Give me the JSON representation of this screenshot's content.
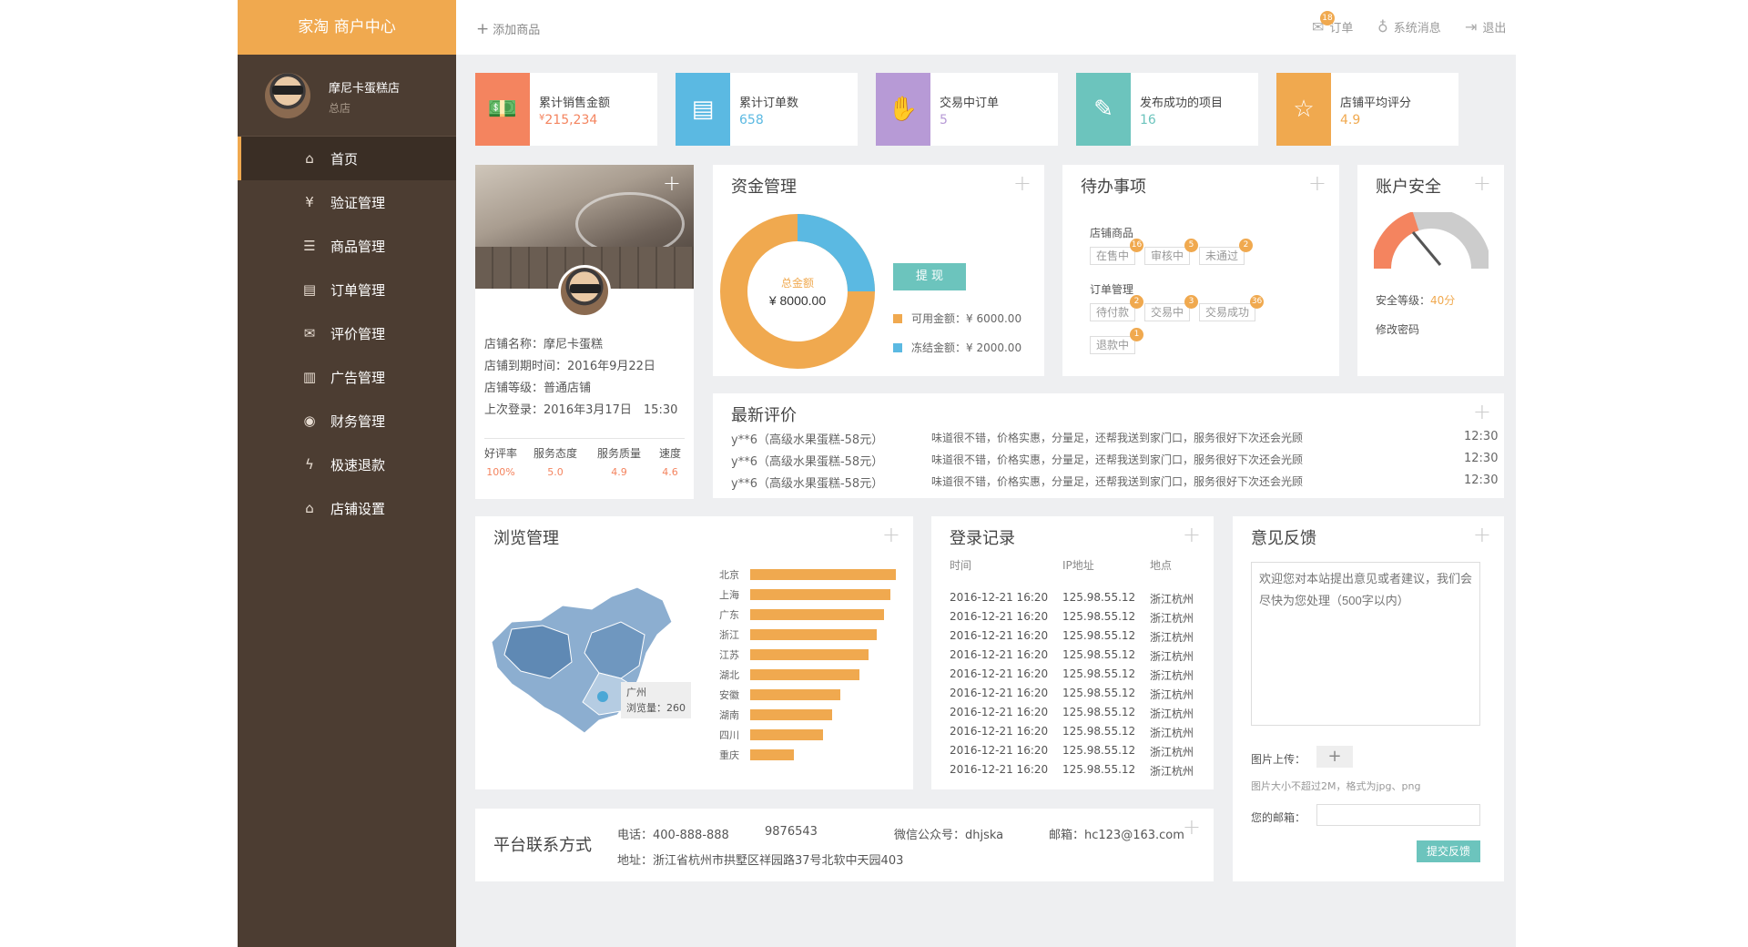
{
  "sidebar": {
    "brand": "家淘 商户中心",
    "user_name": "摩尼卡蛋糕店",
    "user_role": "总店",
    "items": [
      {
        "label": "首页",
        "icon": "home-icon",
        "glyph": "⌂"
      },
      {
        "label": "验证管理",
        "icon": "ticket-icon",
        "glyph": "¥"
      },
      {
        "label": "商品管理",
        "icon": "list-icon",
        "glyph": "☰"
      },
      {
        "label": "订单管理",
        "icon": "order-icon",
        "glyph": "▤"
      },
      {
        "label": "评价管理",
        "icon": "comment-icon",
        "glyph": "✉"
      },
      {
        "label": "广告管理",
        "icon": "grid-icon",
        "glyph": "▥"
      },
      {
        "label": "财务管理",
        "icon": "coins-icon",
        "glyph": "◉"
      },
      {
        "label": "极速退款",
        "icon": "bolt-icon",
        "glyph": "ϟ"
      },
      {
        "label": "店铺设置",
        "icon": "store-icon",
        "glyph": "⌂"
      }
    ]
  },
  "topbar": {
    "add_product": "添加商品",
    "orders_label": "订单",
    "orders_badge": "18",
    "messages_label": "系统消息",
    "logout_label": "退出"
  },
  "stats": [
    {
      "title": "累计销售金额",
      "value": "215,234",
      "currency": "¥",
      "color": "#f4845f",
      "icon": "money-icon",
      "glyph": "💵"
    },
    {
      "title": "累计订单数",
      "value": "658",
      "color": "#5bb9e2",
      "icon": "document-icon",
      "glyph": "▤"
    },
    {
      "title": "交易中订单",
      "value": "5",
      "color": "#b79ad6",
      "icon": "handshake-icon",
      "glyph": "✋"
    },
    {
      "title": "发布成功的项目",
      "value": "16",
      "color": "#6cc4bd",
      "icon": "edit-icon",
      "glyph": "✎"
    },
    {
      "title": "店铺平均评分",
      "value": "4.9",
      "color": "#f0a94f",
      "icon": "star-icon",
      "glyph": "☆"
    }
  ],
  "profile": {
    "name": "店铺名称：摩尼卡蛋糕",
    "expire": "店铺到期时间：2016年9月22日",
    "level": "店铺等级：普通店铺",
    "last_login": "上次登录：2016年3月17日　15:30",
    "metrics": [
      {
        "label": "好评率",
        "value": "100%"
      },
      {
        "label": "服务态度",
        "value": "5.0"
      },
      {
        "label": "服务质量",
        "value": "4.9"
      },
      {
        "label": "速度",
        "value": "4.6"
      }
    ]
  },
  "funds": {
    "title": "资金管理",
    "total_label": "总金额",
    "total_value": "¥ 8000.00",
    "withdraw": "提 现",
    "available": "可用金额：¥ 6000.00",
    "frozen": "冻结金额：¥ 2000.00",
    "available_amount": 6000,
    "frozen_amount": 2000
  },
  "todo": {
    "title": "待办事项",
    "goods_label": "店铺商品",
    "goods": [
      {
        "label": "在售中",
        "badge": "16"
      },
      {
        "label": "审核中",
        "badge": "5"
      },
      {
        "label": "未通过",
        "badge": "2"
      }
    ],
    "orders_label": "订单管理",
    "orders": [
      {
        "label": "待付款",
        "badge": "2"
      },
      {
        "label": "交易中",
        "badge": "3"
      },
      {
        "label": "交易成功",
        "badge": "36"
      }
    ],
    "refund": {
      "label": "退款中",
      "badge": "1"
    }
  },
  "security": {
    "title": "账户安全",
    "level_label": "安全等级：",
    "level_value": "40分",
    "level_fraction": 0.4,
    "change_pwd": "修改密码"
  },
  "reviews": {
    "title": "最新评价",
    "rows": [
      {
        "user": "y**6（高级水果蛋糕-58元）",
        "text": "味道很不错，价格实惠，分量足，还帮我送到家门口，服务很好下次还会光顾",
        "time": "12:30"
      },
      {
        "user": "y**6（高级水果蛋糕-58元）",
        "text": "味道很不错，价格实惠，分量足，还帮我送到家门口，服务很好下次还会光顾",
        "time": "12:30"
      },
      {
        "user": "y**6（高级水果蛋糕-58元）",
        "text": "味道很不错，价格实惠，分量足，还帮我送到家门口，服务很好下次还会光顾",
        "time": "12:30"
      }
    ]
  },
  "browse": {
    "title": "浏览管理",
    "tooltip_city": "广州",
    "tooltip_value": "浏览量：260"
  },
  "chart_data": {
    "type": "bar",
    "categories": [
      "北京",
      "上海",
      "广东",
      "浙江",
      "江苏",
      "湖北",
      "安徽",
      "湖南",
      "四川",
      "重庆"
    ],
    "values": [
      100,
      96,
      92,
      87,
      81,
      75,
      62,
      56,
      50,
      30
    ],
    "xlim": [
      0,
      100
    ]
  },
  "login": {
    "title": "登录记录",
    "headers": [
      "时间",
      "IP地址",
      "地点"
    ],
    "rows": [
      [
        "2016-12-21  16:20",
        "125.98.55.12",
        "浙江杭州"
      ],
      [
        "2016-12-21  16:20",
        "125.98.55.12",
        "浙江杭州"
      ],
      [
        "2016-12-21  16:20",
        "125.98.55.12",
        "浙江杭州"
      ],
      [
        "2016-12-21  16:20",
        "125.98.55.12",
        "浙江杭州"
      ],
      [
        "2016-12-21  16:20",
        "125.98.55.12",
        "浙江杭州"
      ],
      [
        "2016-12-21  16:20",
        "125.98.55.12",
        "浙江杭州"
      ],
      [
        "2016-12-21  16:20",
        "125.98.55.12",
        "浙江杭州"
      ],
      [
        "2016-12-21  16:20",
        "125.98.55.12",
        "浙江杭州"
      ],
      [
        "2016-12-21  16:20",
        "125.98.55.12",
        "浙江杭州"
      ],
      [
        "2016-12-21  16:20",
        "125.98.55.12",
        "浙江杭州"
      ]
    ]
  },
  "feedback": {
    "title": "意见反馈",
    "placeholder": "欢迎您对本站提出意见或者建议，我们会尽快为您处理（500字以内）",
    "upload_label": "图片上传：",
    "upload_hint": "图片大小不超过2M，格式为jpg、png",
    "email_label": "您的邮箱：",
    "submit": "提交反馈"
  },
  "contact": {
    "title": "平台联系方式",
    "phone": "电话：400-888-888",
    "phone2": "9876543",
    "wechat": "微信公众号：dhjska",
    "email": "邮箱：hc123@163.com",
    "address": "地址：浙江省杭州市拱墅区祥园路37号北软中天园403"
  }
}
